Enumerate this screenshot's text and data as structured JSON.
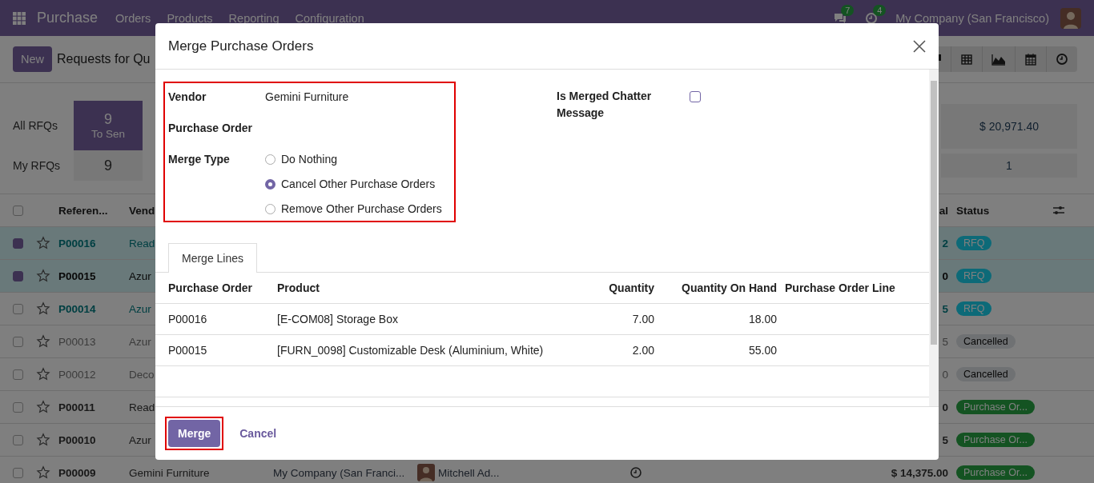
{
  "navbar": {
    "app_name": "Purchase",
    "menu": [
      "Orders",
      "Products",
      "Reporting",
      "Configuration"
    ],
    "messages_badge": "7",
    "activities_badge": "4",
    "company": "My Company (San Francisco)"
  },
  "control_panel": {
    "new_button": "New",
    "title": "Requests for Qu",
    "views": [
      {
        "kind": "kanban"
      },
      {
        "kind": "pivot"
      },
      {
        "kind": "graph"
      },
      {
        "kind": "calendar"
      },
      {
        "kind": "activity"
      }
    ]
  },
  "dashboard": {
    "rows": [
      {
        "label": "All RFQs",
        "tile": {
          "value": "9",
          "caption": "To Sen",
          "selected": true
        },
        "right_tile": "$ 20,971.40"
      },
      {
        "label": "My RFQs",
        "tile": {
          "value": "9",
          "selected": false
        },
        "right_tile": "1"
      }
    ]
  },
  "list": {
    "all_selected": false,
    "columns": {
      "reference": "Referen...",
      "vendor": "Vend",
      "total": "al",
      "status": "Status"
    },
    "rows": [
      {
        "selected": true,
        "kind": "accent",
        "reference": "P00016",
        "vendor": "Read",
        "total": "2",
        "status": {
          "kind": "rfq",
          "label": "RFQ"
        }
      },
      {
        "selected": true,
        "kind": "strong",
        "reference": "P00015",
        "vendor": "Azur",
        "total": "0",
        "status": {
          "kind": "rfq",
          "label": "RFQ"
        }
      },
      {
        "selected": false,
        "kind": "accent",
        "reference": "P00014",
        "vendor": "Azur",
        "total": "5",
        "status": {
          "kind": "rfq",
          "label": "RFQ"
        }
      },
      {
        "selected": false,
        "kind": "muted",
        "reference": "P00013",
        "vendor": "Azur",
        "total": "5",
        "status": {
          "kind": "cancelled",
          "label": "Cancelled"
        }
      },
      {
        "selected": false,
        "kind": "muted",
        "reference": "P00012",
        "vendor": "Deco",
        "total": "0",
        "status": {
          "kind": "cancelled",
          "label": "Cancelled"
        }
      },
      {
        "selected": false,
        "kind": "normal",
        "reference": "P00011",
        "vendor": "Read",
        "total": "0",
        "status": {
          "kind": "done",
          "label": "Purchase Or..."
        }
      },
      {
        "selected": false,
        "kind": "normal",
        "reference": "P00010",
        "vendor": "Azur",
        "total": "5",
        "status": {
          "kind": "done",
          "label": "Purchase Or..."
        }
      },
      {
        "selected": false,
        "kind": "normal",
        "reference": "P00009",
        "vendor": "Gemini Furniture",
        "company": "My Company (San Franci...",
        "buyer": "Mitchell Ad...",
        "activity": true,
        "total": "$ 14,375.00",
        "status": {
          "kind": "done",
          "label": "Purchase Or..."
        }
      }
    ]
  },
  "dialog": {
    "title": "Merge Purchase Orders",
    "highlight_fields": true,
    "fields": {
      "vendor_label": "Vendor",
      "vendor_value": "Gemini Furniture",
      "po_label": "Purchase Order",
      "merge_type_label": "Merge Type",
      "merge_type_options": [
        {
          "label": "Do Nothing",
          "selected": false
        },
        {
          "label": "Cancel Other Purchase Orders",
          "selected": true
        },
        {
          "label": "Remove Other Purchase Orders",
          "selected": false
        }
      ],
      "chatter_label": "Is Merged Chatter Message",
      "chatter_checked": false
    },
    "tabs": [
      {
        "label": "Merge Lines",
        "selected": true
      }
    ],
    "table": {
      "columns": [
        "Purchase Order",
        "Product",
        "Quantity",
        "Quantity On Hand",
        "Purchase Order Line"
      ],
      "rows": [
        [
          "P00016",
          "[E-COM08] Storage Box",
          "7.00",
          "18.00"
        ],
        [
          "P00015",
          "[FURN_0098] Customizable Desk (Aluminium, White)",
          "2.00",
          "55.00"
        ]
      ]
    },
    "buttons": [
      {
        "label": "Merge",
        "kind": "primary",
        "highlighted": true
      },
      {
        "label": "Cancel",
        "kind": "link",
        "highlighted": false
      }
    ]
  }
}
